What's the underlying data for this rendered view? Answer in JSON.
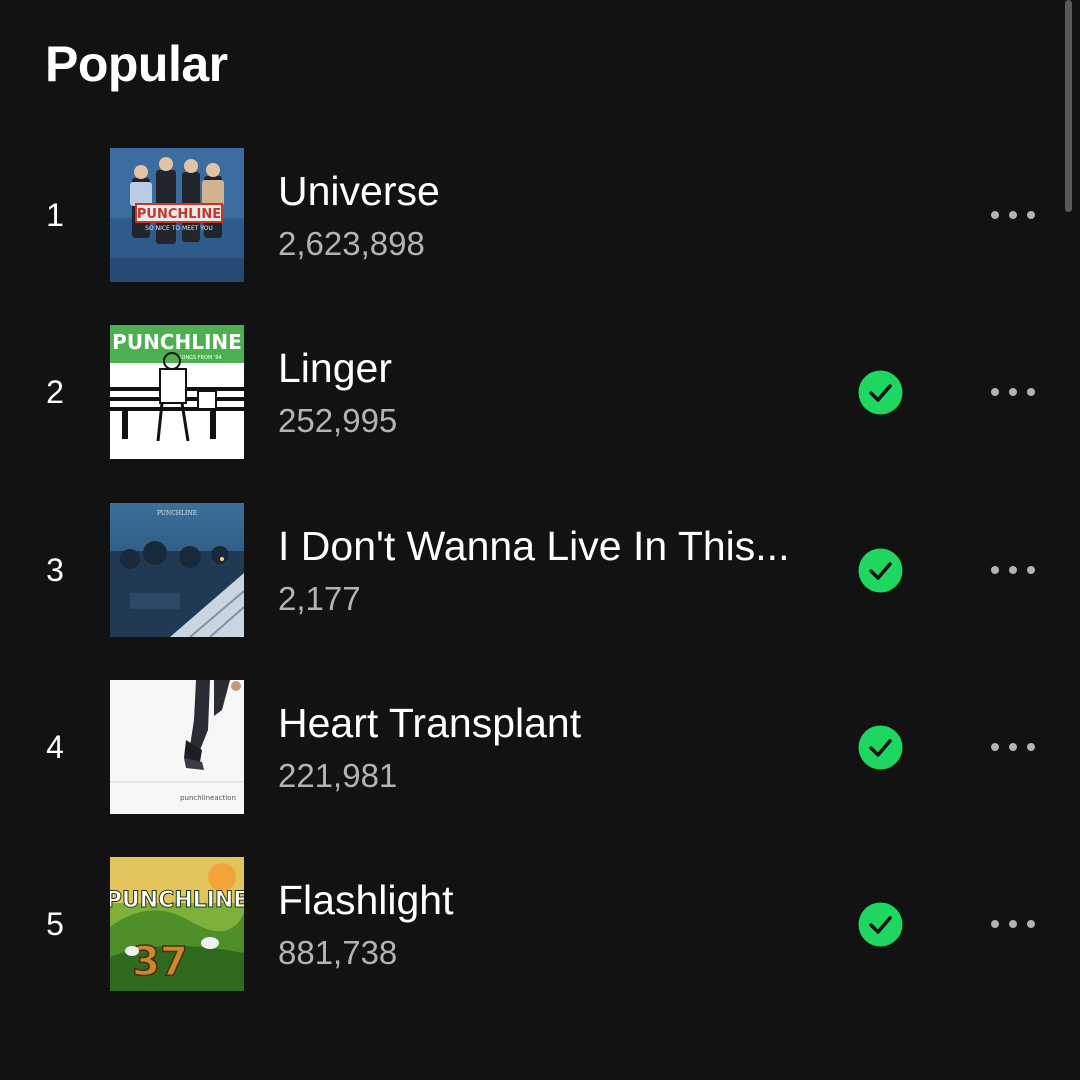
{
  "section": {
    "title": "Popular"
  },
  "colors": {
    "background": "#121212",
    "accent": "#1ed760",
    "secondary_text": "#b3b3b3"
  },
  "icons": {
    "downloaded": "check-circle-icon",
    "more": "more-horizontal-icon"
  },
  "tracks": [
    {
      "number": "1",
      "title": "Universe",
      "plays": "2,623,898",
      "downloaded": false,
      "art": {
        "label": "PUNCHLINE",
        "sublabel": "SO NICE TO MEET YOU"
      }
    },
    {
      "number": "2",
      "title": "Linger",
      "plays": "252,995",
      "downloaded": true,
      "art": {
        "label": "PUNCHLINE",
        "sublabel": "SONGS FROM '94"
      }
    },
    {
      "number": "3",
      "title": "I Don't Wanna Live In This...",
      "plays": "2,177",
      "downloaded": true,
      "art": {
        "label": "PUNCHLINE"
      }
    },
    {
      "number": "4",
      "title": "Heart Transplant",
      "plays": "221,981",
      "downloaded": true,
      "art": {
        "label": "punchlineaction"
      }
    },
    {
      "number": "5",
      "title": "Flashlight",
      "plays": "881,738",
      "downloaded": true,
      "art": {
        "label": "PUNCHLINE",
        "sublabel": "37"
      }
    }
  ]
}
